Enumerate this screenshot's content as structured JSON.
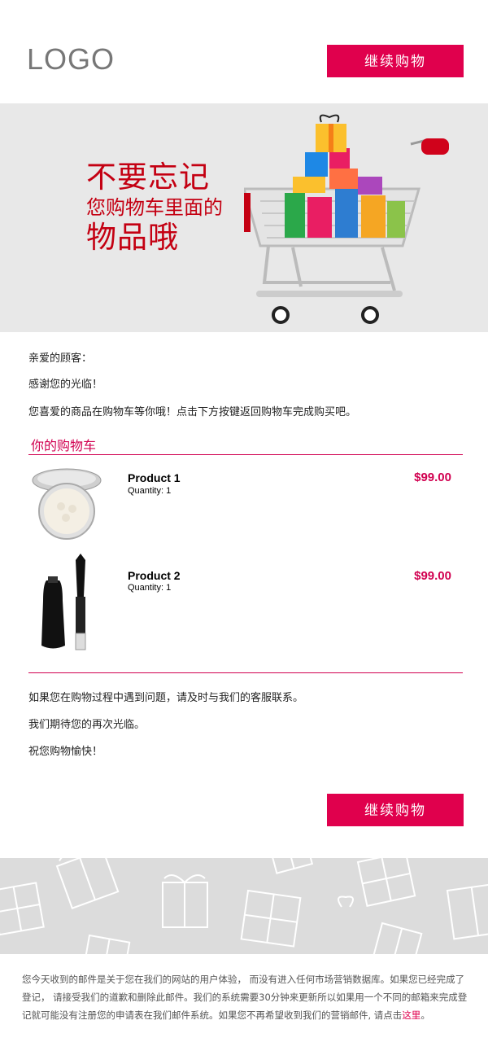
{
  "header": {
    "logo": "LOGO",
    "cta": "继续购物"
  },
  "hero": {
    "line1": "不要忘记",
    "line2": "您购物车里面的",
    "line3": "物品哦"
  },
  "body": {
    "greeting": "亲爱的顾客：",
    "thanks": "感谢您的光临！",
    "reminder": "您喜爱的商品在购物车等你哦！点击下方按键返回购物车完成购买吧。"
  },
  "cart": {
    "title": "你的购物车",
    "products": [
      {
        "name": "Product 1",
        "quantity": "Quantity: 1",
        "price": "$99.00",
        "icon": "compact-powder-icon"
      },
      {
        "name": "Product 2",
        "quantity": "Quantity: 1",
        "price": "$99.00",
        "icon": "mascara-icon"
      }
    ]
  },
  "closing": {
    "help": "如果您在购物过程中遇到问题，请及时与我们的客服联系。",
    "welcome": "我们期待您的再次光临。",
    "wish": "祝您购物愉快！"
  },
  "bottom_cta": "继续购物",
  "footer": {
    "text": "您今天收到的邮件是关于您在我们的网站的用户体验， 而没有进入任何市场营销数据库。如果您已经完成了登记， 请接受我们的道歉和删除此邮件。我们的系统需要30分钟来更新所以如果用一个不同的邮箱来完成登记就可能没有注册您的申请表在我们邮件系统。如果您不再希望收到我们的营销邮件, 请点击",
    "link": "这里",
    "end": "。"
  },
  "colors": {
    "accent": "#e0004d",
    "hero_red": "#c40012",
    "hero_bg": "#e8e8e8",
    "pattern_bg": "#dcdcdc"
  }
}
